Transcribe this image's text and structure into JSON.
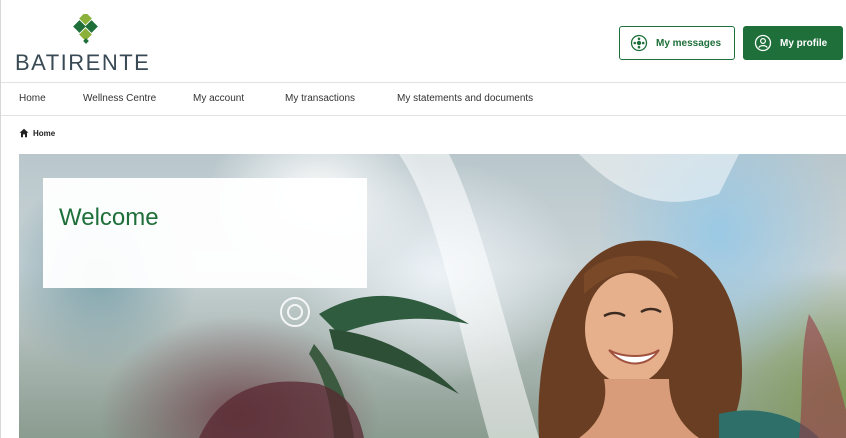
{
  "brand": {
    "name": "BATIRENTE",
    "logo_icon": "diamond-cluster-logo",
    "accent": "#1f6f3a"
  },
  "header": {
    "messages_label": "My messages",
    "messages_icon": "messages-icon",
    "profile_label": "My profile",
    "profile_icon": "profile-icon"
  },
  "nav": {
    "items": [
      {
        "label": "Home"
      },
      {
        "label": "Wellness Centre"
      },
      {
        "label": "My account"
      },
      {
        "label": "My transactions"
      },
      {
        "label": "My statements and documents"
      }
    ]
  },
  "breadcrumb": {
    "home_label": "Home",
    "icon": "home-icon"
  },
  "hero": {
    "welcome_title": "Welcome"
  }
}
